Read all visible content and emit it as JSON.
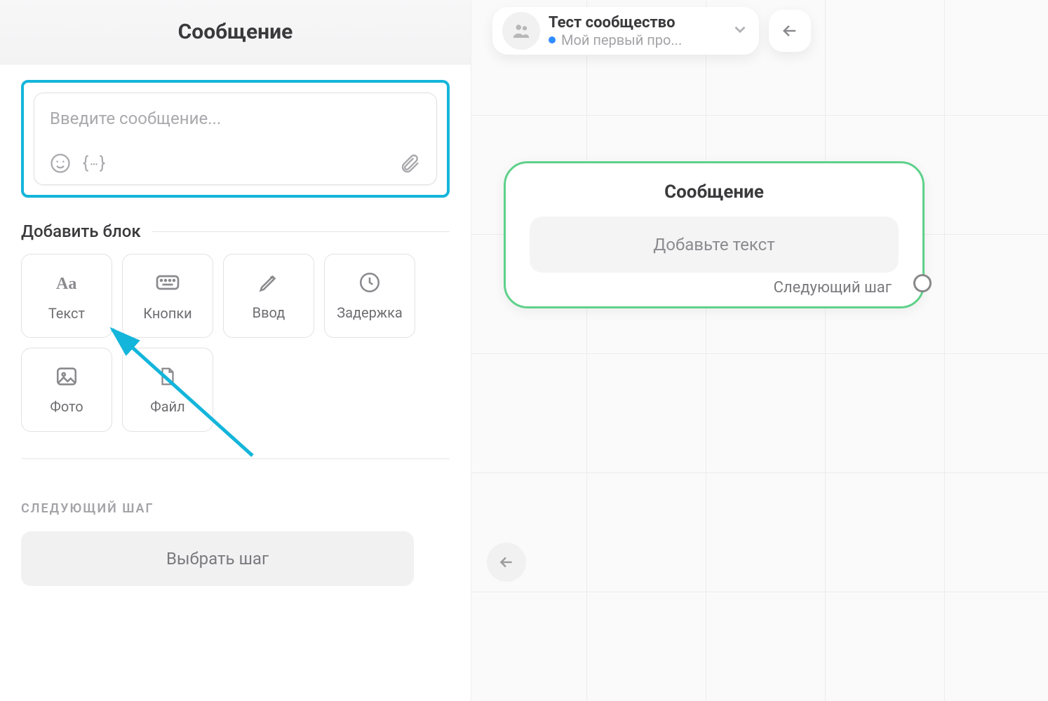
{
  "left": {
    "header_title": "Сообщение",
    "message_placeholder": "Введите сообщение...",
    "add_block_title": "Добавить блок",
    "blocks": {
      "text": "Текст",
      "buttons": "Кнопки",
      "input": "Ввод",
      "delay": "Задержка",
      "photo": "Фото",
      "file": "Файл"
    },
    "next_step_label": "СЛЕДУЮЩИЙ ШАГ",
    "choose_step_button": "Выбрать шаг"
  },
  "right": {
    "group_title": "Тест сообщество",
    "group_subtitle": "Мой первый про...",
    "node": {
      "title": "Сообщение",
      "body_placeholder": "Добавьте текст",
      "next_label": "Следующий шаг"
    }
  },
  "colors": {
    "selection_border": "#14b5da",
    "node_border": "#5ed18a",
    "status_dot": "#2f8cff"
  }
}
